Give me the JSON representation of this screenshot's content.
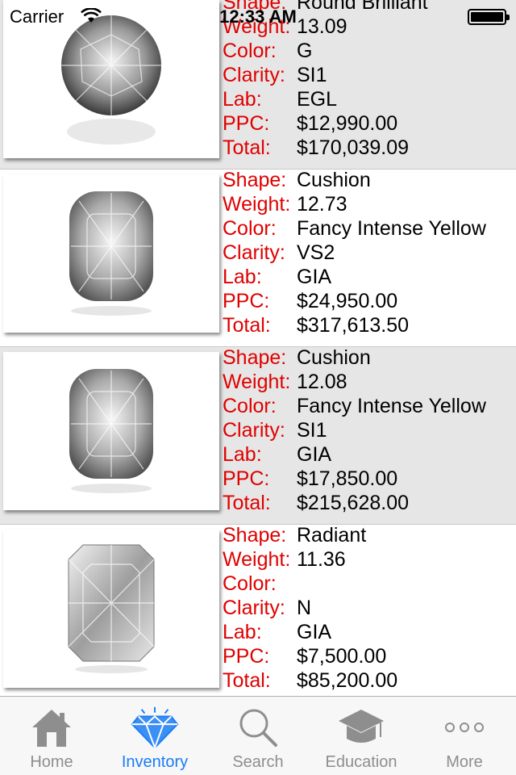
{
  "status_bar": {
    "carrier": "Carrier",
    "time": "12:33 AM"
  },
  "field_labels": {
    "shape": "Shape:",
    "weight": "Weight:",
    "color": "Color:",
    "clarity": "Clarity:",
    "lab": "Lab:",
    "ppc": "PPC:",
    "total": "Total:"
  },
  "colors": {
    "label_red": "#e00000",
    "tab_active": "#1a7cf5",
    "tab_inactive": "#8e8e8e",
    "row_gray": "#e6e6e6"
  },
  "diamonds": [
    {
      "image": "round-diamond-icon",
      "shape": "Round Brilliant",
      "weight": "13.09",
      "color": "G",
      "clarity": "SI1",
      "lab": "EGL",
      "ppc": "$12,990.00",
      "total": "$170,039.09"
    },
    {
      "image": "cushion-diamond-icon",
      "shape": "Cushion",
      "weight": "12.73",
      "color": "Fancy Intense Yellow",
      "clarity": "VS2",
      "lab": "GIA",
      "ppc": "$24,950.00",
      "total": "$317,613.50"
    },
    {
      "image": "cushion-diamond-icon",
      "shape": "Cushion",
      "weight": "12.08",
      "color": "Fancy Intense Yellow",
      "clarity": "SI1",
      "lab": "GIA",
      "ppc": "$17,850.00",
      "total": "$215,628.00"
    },
    {
      "image": "radiant-diamond-icon",
      "shape": "Radiant",
      "weight": "11.36",
      "color": "",
      "clarity": "N",
      "lab": "GIA",
      "ppc": "$7,500.00",
      "total": "$85,200.00"
    }
  ],
  "tabs": [
    {
      "label": "Home",
      "icon": "home-icon"
    },
    {
      "label": "Inventory",
      "icon": "diamond-icon",
      "active": true
    },
    {
      "label": "Search",
      "icon": "search-icon"
    },
    {
      "label": "Education",
      "icon": "graduation-cap-icon"
    },
    {
      "label": "More",
      "icon": "more-icon"
    }
  ]
}
